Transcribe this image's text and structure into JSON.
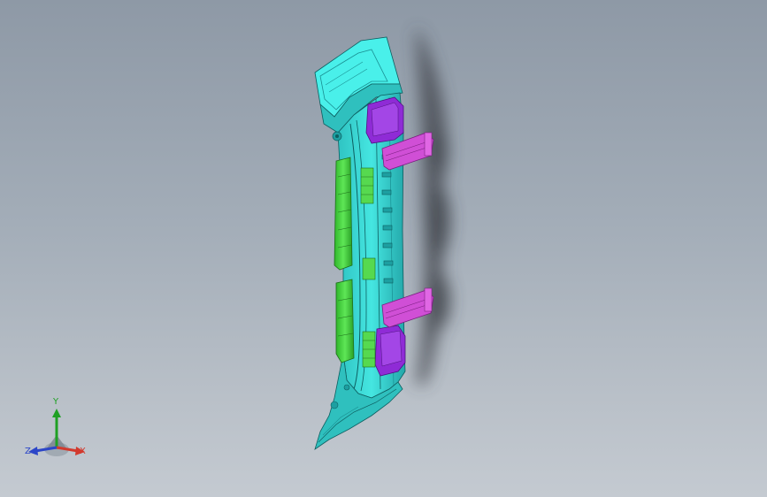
{
  "viewport": {
    "background_top": "#8e99a6",
    "background_bottom": "#c4cad1"
  },
  "model": {
    "colors": {
      "body": "#35d3d0",
      "body_light": "#4ff0ea",
      "body_dark": "#178f92",
      "edge": "#0d5e60",
      "ribs": "#3fd13a",
      "ribs_dark": "#1e8a1b",
      "clips": "#d04fd6",
      "pads": "#8f2bd6"
    }
  },
  "triad": {
    "y_label": "Y",
    "x_label": "X",
    "z_label": "Z",
    "y_color": "#1fa024",
    "x_color": "#d23a2e",
    "z_color": "#2c46c8",
    "icon": "view-orientation-triad-icon"
  }
}
